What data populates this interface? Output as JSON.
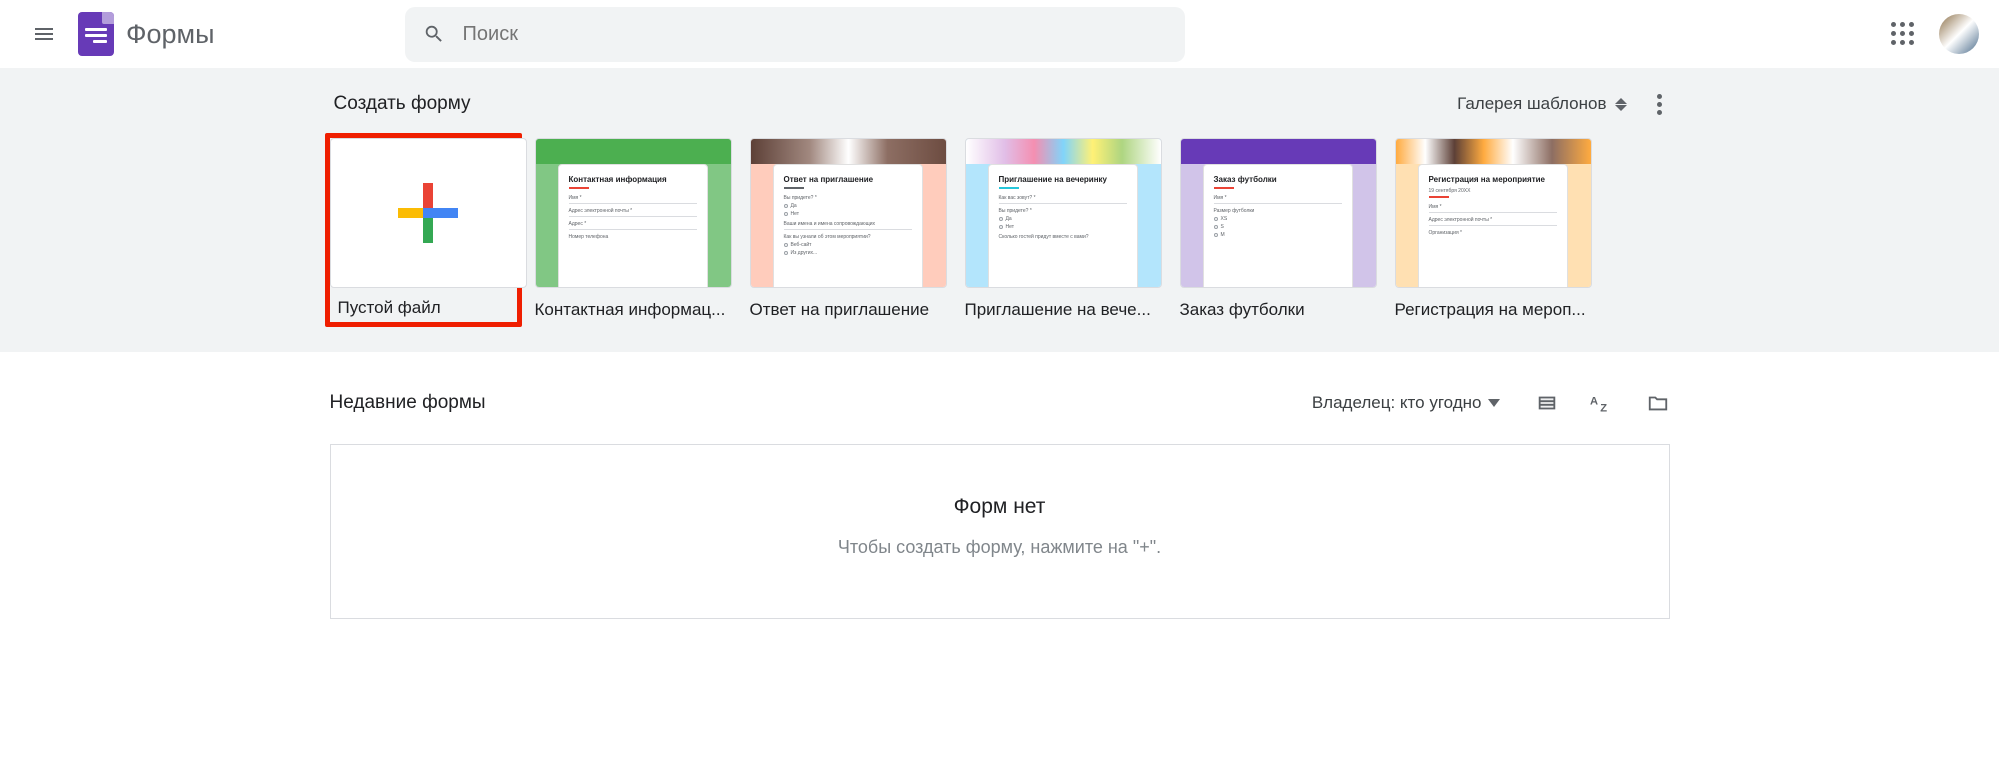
{
  "header": {
    "app_title": "Формы",
    "search_placeholder": "Поиск"
  },
  "gallery": {
    "section_title": "Создать форму",
    "gallery_button": "Галерея шаблонов",
    "templates": [
      {
        "label": "Пустой файл",
        "form_title": ""
      },
      {
        "label": "Контактная информац...",
        "form_title": "Контактная информация",
        "accent": "#ea4335",
        "fields": [
          "Имя *",
          "Адрес электронной почты *",
          "Адрес *",
          "Номер телефона"
        ]
      },
      {
        "label": "Ответ на приглашение",
        "form_title": "Ответ на приглашение",
        "accent": "#5f6368",
        "fields": [
          "Вы придете? *"
        ],
        "options": [
          "Да",
          "Нет"
        ],
        "extra": "Ваши имена и имена сопровождающих"
      },
      {
        "label": "Приглашение на вече...",
        "form_title": "Приглашение на вечеринку",
        "accent": "#26c6da",
        "fields": [
          "Как вас зовут? *",
          "Вы придете? *"
        ],
        "options": [
          "Да",
          "Нет"
        ],
        "extra": "Сколько гостей придут вместе с вами?"
      },
      {
        "label": "Заказ футболки",
        "form_title": "Заказ футболки",
        "accent": "#ea4335",
        "fields": [
          "Имя *",
          "Размер футболки"
        ],
        "options": [
          "XS",
          "S",
          "M"
        ]
      },
      {
        "label": "Регистрация на мероп...",
        "form_title": "Регистрация на мероприятие",
        "accent": "#ea4335",
        "sub": "19 сентября 20XX",
        "fields": [
          "Имя *",
          "Адрес электронной почты *",
          "Организация *"
        ]
      }
    ]
  },
  "recent": {
    "section_title": "Недавние формы",
    "owner_filter": "Владелец: кто угодно",
    "empty_title": "Форм нет",
    "empty_subtitle": "Чтобы создать форму, нажмите на \"+\"."
  }
}
